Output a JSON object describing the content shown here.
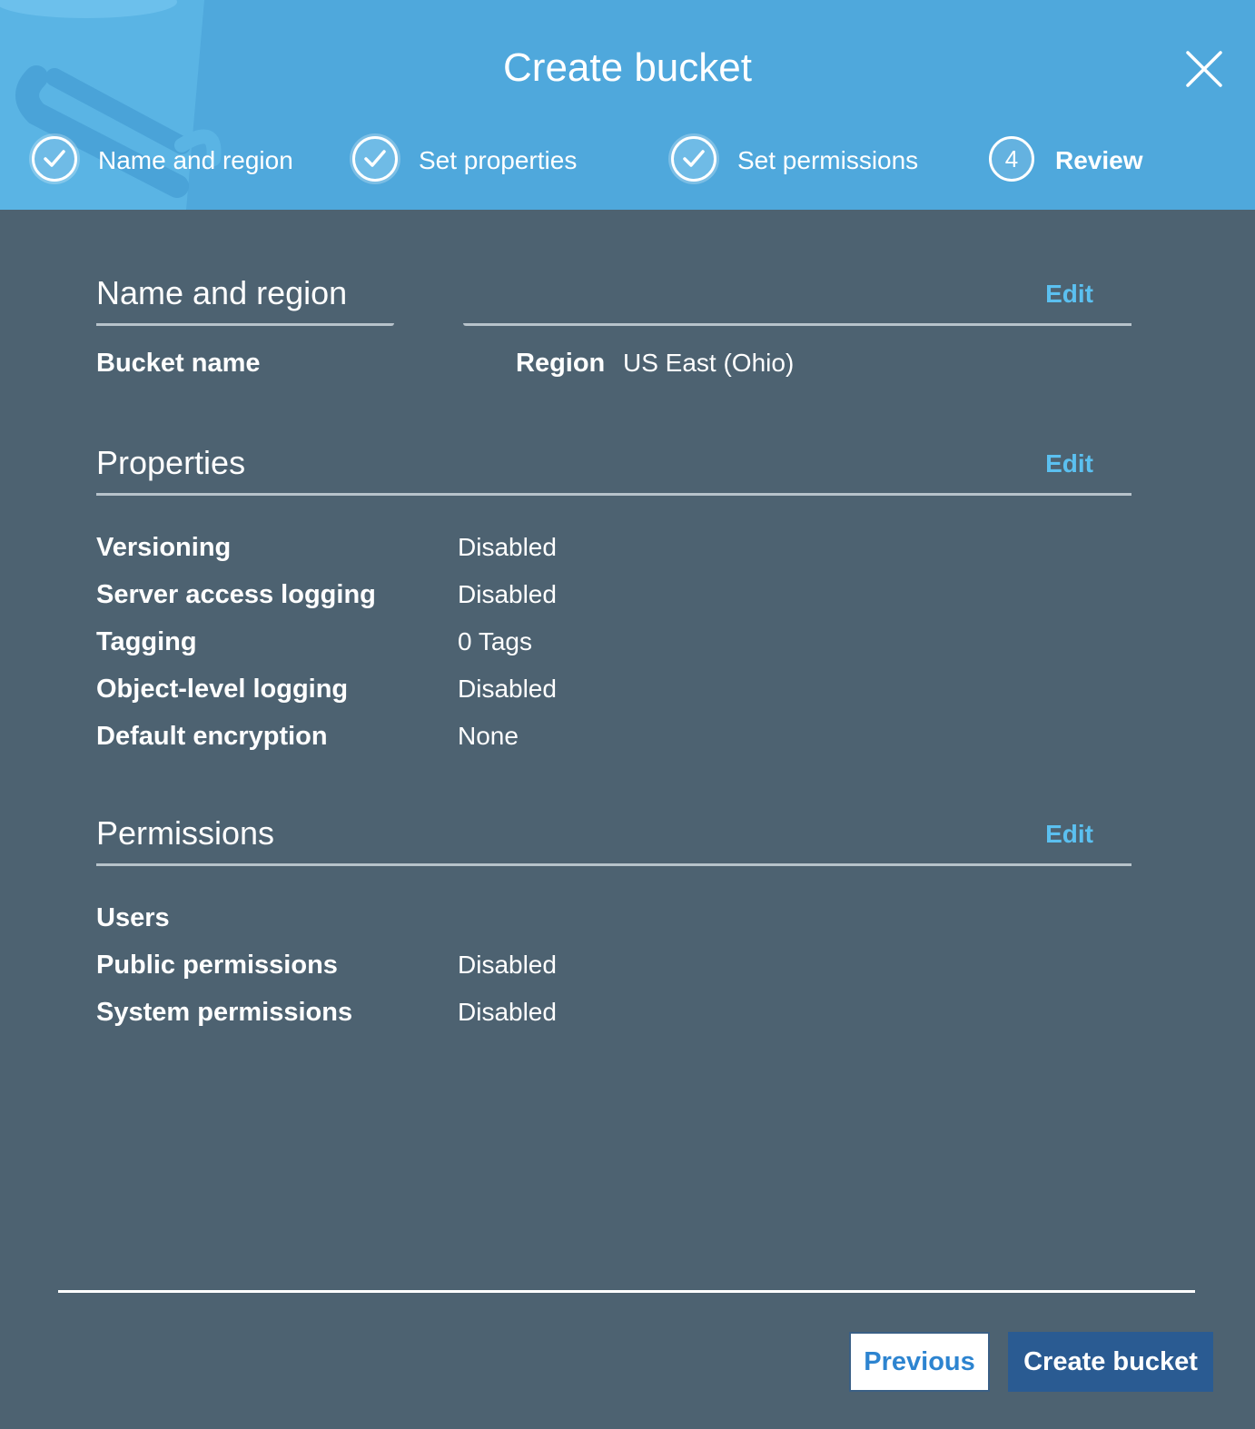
{
  "modal": {
    "title": "Create bucket",
    "close_icon": "close-icon"
  },
  "steps": [
    {
      "label": "Name and region",
      "state": "done",
      "icon": "check-icon"
    },
    {
      "label": "Set properties",
      "state": "done",
      "icon": "check-icon"
    },
    {
      "label": "Set permissions",
      "state": "done",
      "icon": "check-icon"
    },
    {
      "label": "Review",
      "state": "active",
      "number": "4"
    }
  ],
  "sections": {
    "name_region": {
      "title": "Name and region",
      "edit_label": "Edit",
      "bucket_name_label": "Bucket name",
      "bucket_name_value": "",
      "region_label": "Region",
      "region_value": "US East (Ohio)"
    },
    "properties": {
      "title": "Properties",
      "edit_label": "Edit",
      "rows": [
        {
          "label": "Versioning",
          "value": "Disabled"
        },
        {
          "label": "Server access logging",
          "value": "Disabled"
        },
        {
          "label": "Tagging",
          "value": "0 Tags"
        },
        {
          "label": "Object-level logging",
          "value": "Disabled"
        },
        {
          "label": "Default encryption",
          "value": "None"
        }
      ]
    },
    "permissions": {
      "title": "Permissions",
      "edit_label": "Edit",
      "rows": [
        {
          "label": "Users",
          "value": ""
        },
        {
          "label": "Public permissions",
          "value": "Disabled"
        },
        {
          "label": "System permissions",
          "value": "Disabled"
        }
      ]
    }
  },
  "footer": {
    "previous_label": "Previous",
    "create_label": "Create bucket"
  },
  "colors": {
    "header_bg": "#4fa8dc",
    "body_bg": "#4d6271",
    "link": "#5bc0f0",
    "primary_button": "#2a5b92"
  }
}
